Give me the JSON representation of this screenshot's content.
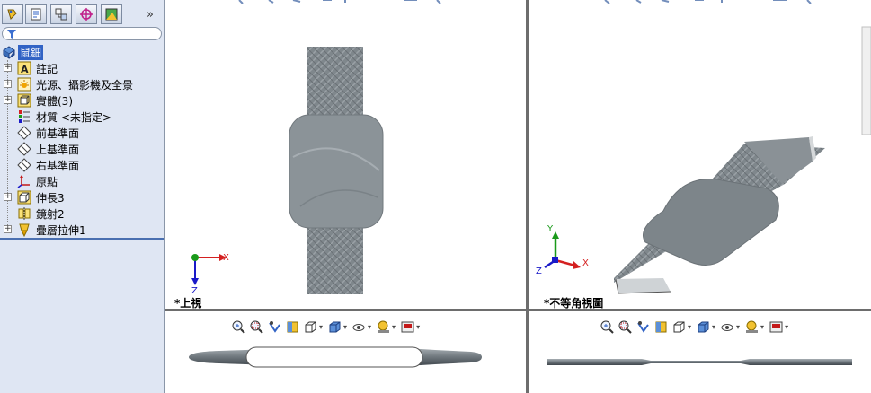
{
  "feature_tree": {
    "root_label": "鼠鈿",
    "items": [
      {
        "label": "註記",
        "icon": "annotation-icon",
        "expandable": true
      },
      {
        "label": "光源、攝影機及全景",
        "icon": "lights-icon",
        "expandable": true
      },
      {
        "label": "實體(3)",
        "icon": "solid-bodies-icon",
        "expandable": true
      },
      {
        "label": "材質 <未指定>",
        "icon": "material-icon",
        "expandable": false
      },
      {
        "label": "前基準面",
        "icon": "plane-icon",
        "expandable": false
      },
      {
        "label": "上基準面",
        "icon": "plane-icon",
        "expandable": false
      },
      {
        "label": "右基準面",
        "icon": "plane-icon",
        "expandable": false
      },
      {
        "label": "原點",
        "icon": "origin-icon",
        "expandable": false
      },
      {
        "label": "伸長3",
        "icon": "extrude-icon",
        "expandable": true
      },
      {
        "label": "鏡射2",
        "icon": "mirror-icon",
        "expandable": false
      },
      {
        "label": "疊層拉伸1",
        "icon": "loft-icon",
        "expandable": true
      }
    ],
    "more_label": "»"
  },
  "viewports": {
    "top_left_label": "*上視",
    "top_right_label": "*不等角視圖",
    "triad_top": {
      "x": "X",
      "z": "Z"
    },
    "triad_iso": {
      "x": "X",
      "y": "Y",
      "z": "Z"
    }
  },
  "colors": {
    "panel_bg": "#dfe6f3",
    "selection": "#3163c5",
    "x_axis": "#d42020",
    "y_axis": "#1a9a1a",
    "z_axis": "#1a1ac8"
  }
}
